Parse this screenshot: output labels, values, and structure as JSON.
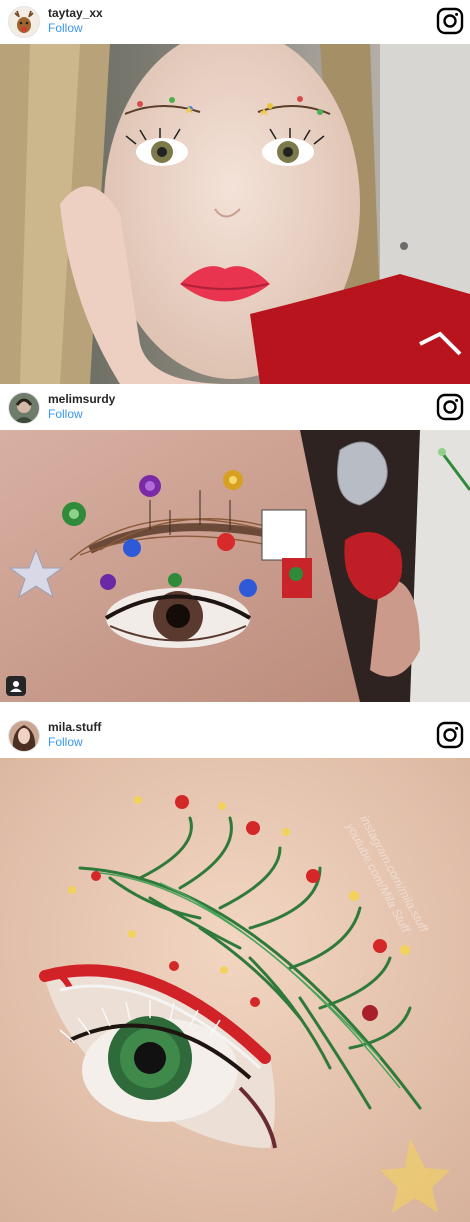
{
  "posts": [
    {
      "username": "taytay_xx",
      "follow_label": "Follow",
      "avatar_icon": "reindeer-avatar"
    },
    {
      "username": "melimsurdy",
      "follow_label": "Follow",
      "avatar_icon": "photo-avatar"
    },
    {
      "username": "mila.stuff",
      "follow_label": "Follow",
      "avatar_icon": "photo-avatar"
    }
  ],
  "watermark": {
    "line1": "instagram.com/mila.stuff",
    "line2": "youtube.com/Mila Stuff"
  },
  "colors": {
    "link": "#3897f0",
    "text": "#262626"
  }
}
